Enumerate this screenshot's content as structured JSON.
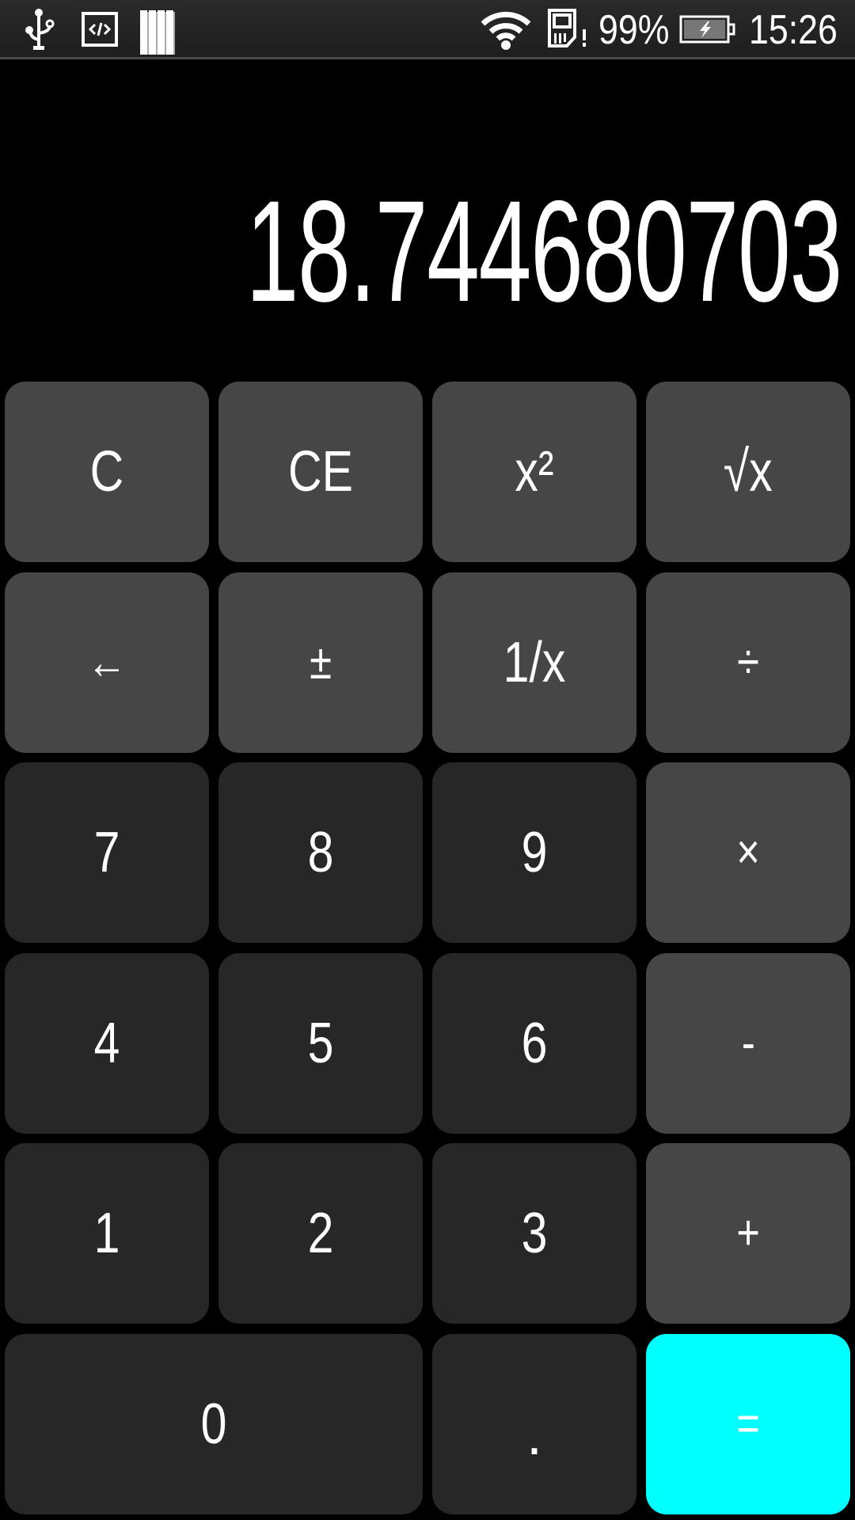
{
  "status_bar": {
    "left_icons": [
      "usb-icon",
      "developer-code-icon",
      "storage-bars-icon"
    ],
    "right_icons": [
      "wifi-icon",
      "sd-card-warning-icon",
      "battery-charging-icon"
    ],
    "battery_percent": "99%",
    "time": "15:26"
  },
  "display": {
    "value": "18.744680703"
  },
  "colors": {
    "function_key": "#464646",
    "digit_key": "#272727",
    "equals_key": "#00ffff",
    "background": "#000000",
    "text": "#ffffff"
  },
  "keypad": {
    "rows": [
      [
        {
          "label": "C",
          "name": "clear"
        },
        {
          "label": "CE",
          "name": "clear-entry"
        },
        {
          "label": "x²",
          "name": "square"
        },
        {
          "label": "√x",
          "name": "square-root"
        }
      ],
      [
        {
          "label": "←",
          "name": "backspace"
        },
        {
          "label": "±",
          "name": "plus-minus"
        },
        {
          "label": "1/x",
          "name": "reciprocal"
        },
        {
          "label": "÷",
          "name": "divide"
        }
      ],
      [
        {
          "label": "7",
          "name": "seven"
        },
        {
          "label": "8",
          "name": "eight"
        },
        {
          "label": "9",
          "name": "nine"
        },
        {
          "label": "×",
          "name": "multiply"
        }
      ],
      [
        {
          "label": "4",
          "name": "four"
        },
        {
          "label": "5",
          "name": "five"
        },
        {
          "label": "6",
          "name": "six"
        },
        {
          "label": "-",
          "name": "subtract"
        }
      ],
      [
        {
          "label": "1",
          "name": "one"
        },
        {
          "label": "2",
          "name": "two"
        },
        {
          "label": "3",
          "name": "three"
        },
        {
          "label": "+",
          "name": "add"
        }
      ],
      [
        {
          "label": "0",
          "name": "zero"
        },
        {
          "label": ".",
          "name": "decimal"
        },
        {
          "label": "=",
          "name": "equals"
        }
      ]
    ]
  }
}
